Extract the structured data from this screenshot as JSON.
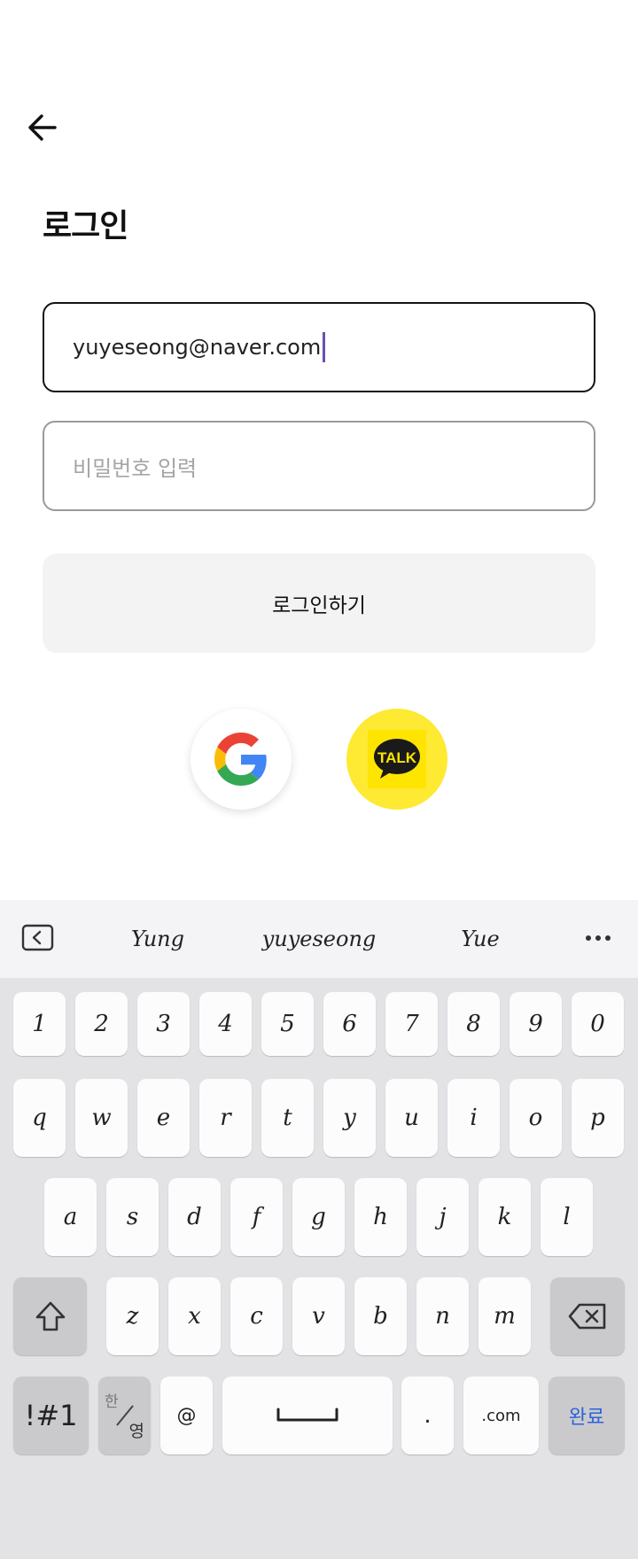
{
  "header": {
    "back_icon": "arrow-left-icon",
    "title": "로그인"
  },
  "form": {
    "email_value": "yuyeseong@naver.com",
    "password_placeholder": "비밀번호 입력",
    "login_button_label": "로그인하기"
  },
  "social": {
    "google_icon": "google-logo-icon",
    "kakao_icon": "kakao-talk-icon",
    "kakao_text": "TALK",
    "kakao_color": "#FEE500"
  },
  "keyboard": {
    "suggestions": [
      "Yung",
      "yuyeseong",
      "Yue"
    ],
    "number_row": [
      "1",
      "2",
      "3",
      "4",
      "5",
      "6",
      "7",
      "8",
      "9",
      "0"
    ],
    "row1": [
      "q",
      "w",
      "e",
      "r",
      "t",
      "y",
      "u",
      "i",
      "o",
      "p"
    ],
    "row2": [
      "a",
      "s",
      "d",
      "f",
      "g",
      "h",
      "j",
      "k",
      "l"
    ],
    "row3": [
      "z",
      "x",
      "c",
      "v",
      "b",
      "n",
      "m"
    ],
    "symbol_key": "!#1",
    "lang_top": "한",
    "lang_bottom": "영",
    "at_key": "@",
    "period_key": ".",
    "dotcom_key": ".com",
    "done_key": "완료",
    "done_color": "#2B63D9"
  }
}
